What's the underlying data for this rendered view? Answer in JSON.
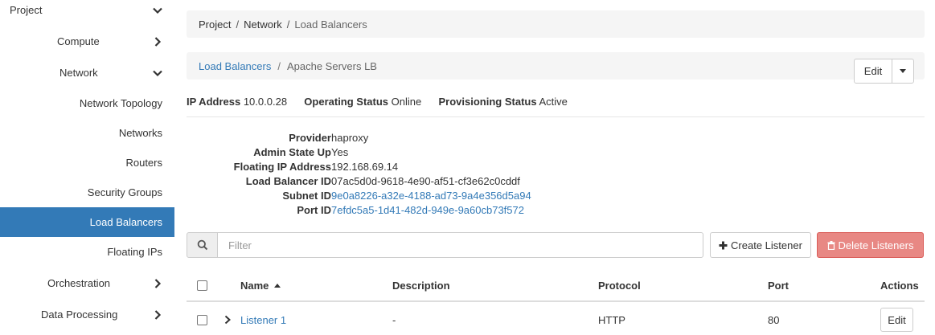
{
  "sidebar": {
    "items": [
      {
        "label": "Project",
        "chevron": "down"
      },
      {
        "label": "Compute",
        "chevron": "right"
      },
      {
        "label": "Network",
        "chevron": "down"
      },
      {
        "label": "Network Topology"
      },
      {
        "label": "Networks"
      },
      {
        "label": "Routers"
      },
      {
        "label": "Security Groups"
      },
      {
        "label": "Load Balancers",
        "active": true
      },
      {
        "label": "Floating IPs"
      },
      {
        "label": "Orchestration",
        "chevron": "right"
      },
      {
        "label": "Data Processing",
        "chevron": "right"
      }
    ]
  },
  "breadcrumb_top": {
    "items": [
      "Project",
      "Network",
      "Load Balancers"
    ]
  },
  "breadcrumb_detail": {
    "link": "Load Balancers",
    "current": "Apache Servers LB"
  },
  "actions": {
    "edit_label": "Edit"
  },
  "status": {
    "ip_label": "IP Address",
    "ip_value": "10.0.0.28",
    "op_label": "Operating Status",
    "op_value": "Online",
    "prov_label": "Provisioning Status",
    "prov_value": "Active"
  },
  "details": [
    {
      "label": "Provider",
      "value": "haproxy",
      "link": false
    },
    {
      "label": "Admin State Up",
      "value": "Yes",
      "link": false
    },
    {
      "label": "Floating IP Address",
      "value": "192.168.69.14",
      "link": false
    },
    {
      "label": "Load Balancer ID",
      "value": "07ac5d0d-9618-4e90-af51-cf3e62c0cddf",
      "link": false
    },
    {
      "label": "Subnet ID",
      "value": "9e0a8226-a32e-4188-ad73-9a4e356d5a94",
      "link": true
    },
    {
      "label": "Port ID",
      "value": "7efdc5a5-1d41-482d-949e-9a60cb73f572",
      "link": true
    }
  ],
  "filter": {
    "placeholder": "Filter"
  },
  "buttons": {
    "create": "Create Listener",
    "delete": "Delete Listeners"
  },
  "table": {
    "headers": {
      "name": "Name",
      "description": "Description",
      "protocol": "Protocol",
      "port": "Port",
      "actions": "Actions"
    },
    "rows": [
      {
        "name": "Listener 1",
        "description": "-",
        "protocol": "HTTP",
        "port": "80",
        "action": "Edit"
      }
    ]
  },
  "colors": {
    "accent": "#337ab7",
    "danger": "#d9534f"
  }
}
